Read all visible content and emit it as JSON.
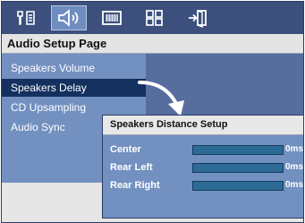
{
  "tabs": [
    {
      "icon": "general-setup-icon",
      "active": false
    },
    {
      "icon": "speaker-audio-icon",
      "active": true
    },
    {
      "icon": "video-screen-icon",
      "active": false
    },
    {
      "icon": "preferences-grid-icon",
      "active": false
    },
    {
      "icon": "exit-door-icon",
      "active": false
    }
  ],
  "page_title": "Audio Setup Page",
  "menu": {
    "items": [
      {
        "label": "Speakers Volume",
        "selected": false
      },
      {
        "label": "Speakers Delay",
        "selected": true
      },
      {
        "label": "CD Upsampling",
        "selected": false
      },
      {
        "label": "Audio Sync",
        "selected": false
      }
    ]
  },
  "popup": {
    "title": "Speakers Distance Setup",
    "rows": [
      {
        "label": "Center",
        "value": "0ms"
      },
      {
        "label": "Rear Left",
        "value": "0ms"
      },
      {
        "label": "Rear Right",
        "value": "0ms"
      }
    ]
  },
  "colors": {
    "tabbar": "#3c4f7d",
    "menu_bg": "#7290c0",
    "selected_item": "#13305f",
    "slider_fill": "#2b6b96"
  }
}
